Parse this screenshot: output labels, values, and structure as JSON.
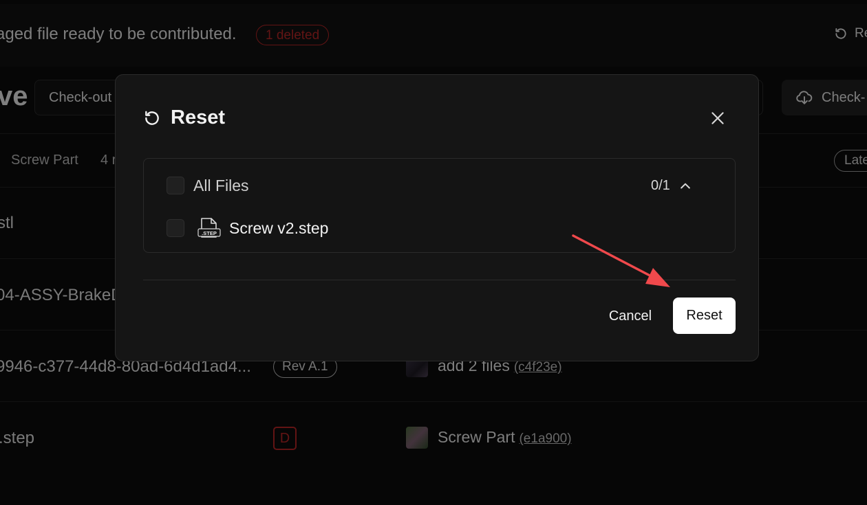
{
  "background": {
    "staged_message": "aged file ready to be contributed.",
    "deleted_badge": "1 deleted",
    "top_reset_label": "Re",
    "title_fragment": "ve",
    "checkout_left_label": "Check-out",
    "checkout_right_label": "Check-",
    "breadcrumb_part": "Screw Part",
    "breadcrumb_count": "4 r",
    "latest_label": "Late",
    "rows": [
      {
        "name": "stl"
      },
      {
        "name": "04-ASSY-BrakeD"
      },
      {
        "name": "9946-c377-44d8-80ad-6d4d1ad4...",
        "revision": "Rev A.1",
        "commit_message": "add 2 files",
        "commit_hash": "(c4f23e)"
      },
      {
        "name": ".step",
        "status_badge": "D",
        "commit_message": "Screw Part",
        "commit_hash": "(e1a900)"
      }
    ]
  },
  "modal": {
    "title": "Reset",
    "all_files_label": "All Files",
    "selected_count": "0/1",
    "files": [
      {
        "name": "Screw v2.step",
        "icon_label": ".STEP"
      }
    ],
    "cancel_label": "Cancel",
    "reset_label": "Reset"
  },
  "colors": {
    "background": "#0b0b0b",
    "modal_background": "#151515",
    "danger": "#b32626",
    "primary_button": "#ffffff",
    "annotation_arrow": "#f0494c"
  }
}
